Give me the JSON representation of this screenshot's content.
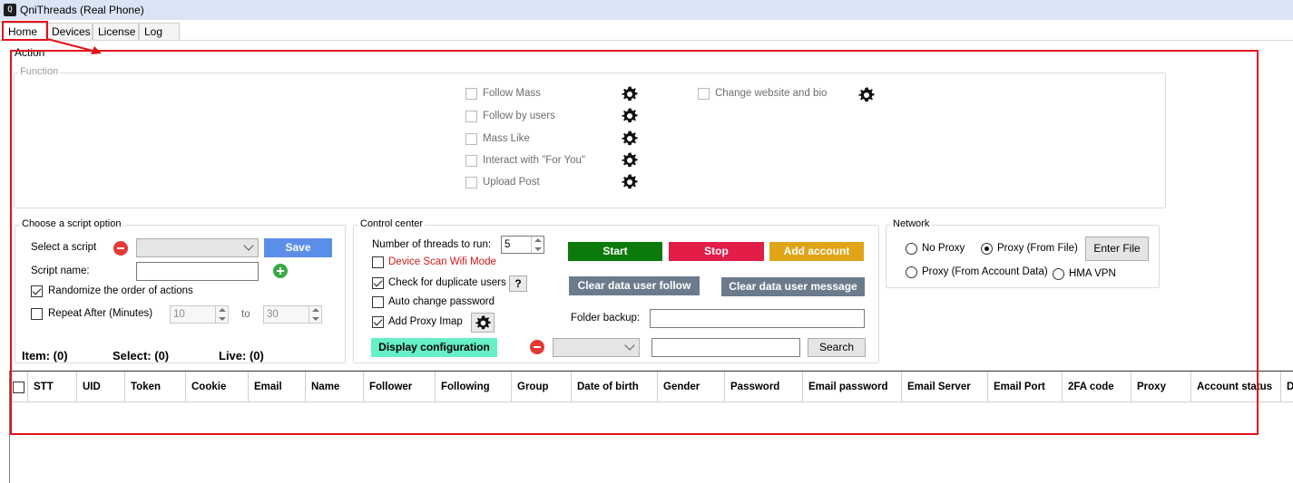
{
  "window": {
    "title": "QniThreads (Real Phone)"
  },
  "tabs": [
    "Home",
    "Devices",
    "License",
    "Log"
  ],
  "action": {
    "label": "Action",
    "function": {
      "label": "Function",
      "col1": [
        "Follow Mass",
        "Follow by users",
        "Mass Like",
        "Interact with \"For You\"",
        "Upload Post"
      ],
      "col2": [
        "Change website and bio"
      ]
    }
  },
  "script_option": {
    "label": "Choose a script option",
    "select_label": "Select a script",
    "save_label": "Save",
    "script_name_label": "Script name:",
    "script_name_value": "",
    "randomize_label": "Randomize the order of actions",
    "randomize_checked": true,
    "repeat_label": "Repeat After (Minutes)",
    "repeat_checked": false,
    "repeat_from": "10",
    "to_label": "to",
    "repeat_to": "30"
  },
  "counts": {
    "item": "Item: (0)",
    "select": "Select: (0)",
    "live": "Live: (0)"
  },
  "control_center": {
    "label": "Control center",
    "threads_label": "Number of threads to run:",
    "threads_value": "5",
    "device_scan_label": "Device Scan Wifi Mode",
    "check_dup_label": "Check for duplicate users",
    "help_label": "?",
    "auto_change_label": "Auto change password",
    "add_proxy_label": "Add Proxy Imap",
    "display_config_label": "Display configuration",
    "start_label": "Start",
    "stop_label": "Stop",
    "add_account_label": "Add account",
    "clear_follow_label": "Clear data user follow",
    "clear_message_label": "Clear data user message",
    "folder_backup_label": "Folder backup:",
    "folder_backup_value": "",
    "search_value": "",
    "search_label": "Search"
  },
  "network": {
    "label": "Network",
    "no_proxy": "No Proxy",
    "proxy_file": "Proxy (From File)",
    "enter_file": "Enter File",
    "proxy_account": "Proxy (From Account Data)",
    "hma_vpn": "HMA VPN",
    "selected": "Proxy (From File)"
  },
  "table": {
    "columns": [
      "STT",
      "UID",
      "Token",
      "Cookie",
      "Email",
      "Name",
      "Follower",
      "Following",
      "Group",
      "Date of birth",
      "Gender",
      "Password",
      "Email password",
      "Email Server",
      "Email Port",
      "2FA code",
      "Proxy",
      "Account status",
      "D"
    ],
    "rows": []
  },
  "colors": {
    "start": "#0b7a0b",
    "stop": "#e11d48",
    "add_account": "#e0a417",
    "clear": "#6c7b8c",
    "save": "#5b8ee8",
    "display_config": "#66f0c8",
    "annotation": "#e5121c"
  }
}
